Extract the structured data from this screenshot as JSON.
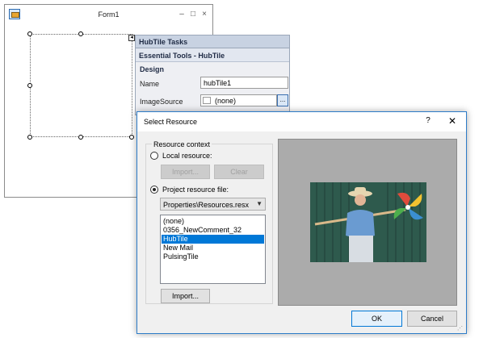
{
  "form": {
    "title": "Form1",
    "minimize_glyph": "–",
    "maximize_glyph": "□",
    "close_glyph": "×"
  },
  "smart_tag": {
    "glyph": "◂"
  },
  "tasks_panel": {
    "header": "HubTile Tasks",
    "subheader": "Essential Tools - HubTile",
    "section": "Design",
    "name_label": "Name",
    "name_value": "hubTile1",
    "imagesource_label": "ImageSource",
    "imagesource_value": "(none)",
    "browse_label": "..."
  },
  "dialog": {
    "title": "Select Resource",
    "help_glyph": "?",
    "close_glyph": "✕",
    "group_label": "Resource context",
    "local_resource_label": "Local resource:",
    "local_import_label": "Import...",
    "local_clear_label": "Clear",
    "project_resource_label": "Project resource file:",
    "resource_file": "Properties\\Resources.resx",
    "resources": [
      "(none)",
      "0356_NewComment_32",
      "HubTile",
      "New Mail",
      "PulsingTile"
    ],
    "selected_resource": "HubTile",
    "import_label": "Import...",
    "ok_label": "OK",
    "cancel_label": "Cancel"
  },
  "colors": {
    "accent": "#0078d7",
    "tasks_header_bg": "#c8d2e2",
    "preview_bg": "#ababab"
  }
}
